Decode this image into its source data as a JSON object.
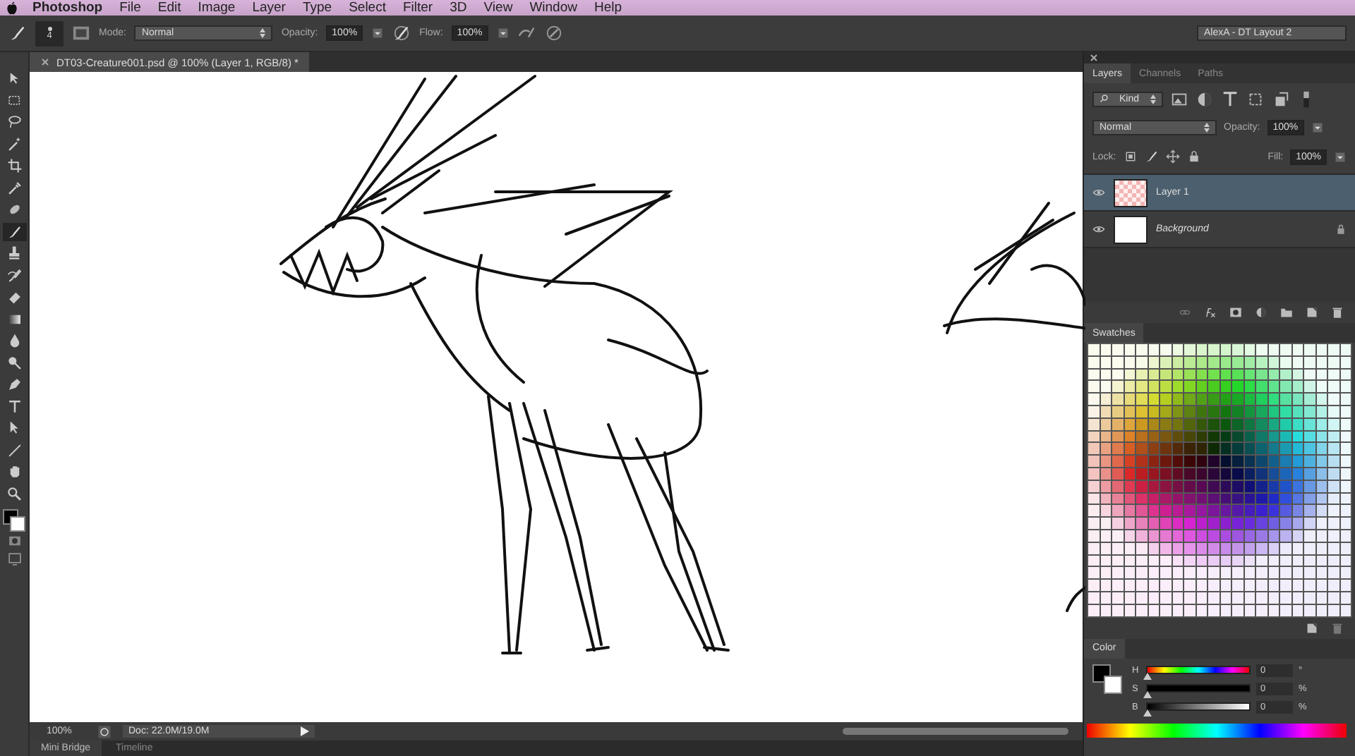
{
  "menu_bar": {
    "items": [
      "Photoshop",
      "File",
      "Edit",
      "Image",
      "Layer",
      "Type",
      "Select",
      "Filter",
      "3D",
      "View",
      "Window",
      "Help"
    ]
  },
  "options_bar": {
    "brush_size": "4",
    "mode_label": "Mode:",
    "mode": "Normal",
    "opacity_label": "Opacity:",
    "opacity": "100%",
    "flow_label": "Flow:",
    "flow": "100%",
    "workspace": "AlexA - DT Layout 2"
  },
  "tools": [
    {
      "kind": "move",
      "selected": false
    },
    {
      "kind": "marquee",
      "selected": false
    },
    {
      "kind": "lasso",
      "selected": false
    },
    {
      "kind": "wand",
      "selected": false
    },
    {
      "kind": "crop",
      "selected": false
    },
    {
      "kind": "eyedropper",
      "selected": false
    },
    {
      "kind": "healing",
      "selected": false
    },
    {
      "kind": "brush",
      "selected": true
    },
    {
      "kind": "stamp",
      "selected": false
    },
    {
      "kind": "history",
      "selected": false
    },
    {
      "kind": "eraser",
      "selected": false
    },
    {
      "kind": "gradient",
      "selected": false
    },
    {
      "kind": "blur",
      "selected": false
    },
    {
      "kind": "dodge",
      "selected": false
    },
    {
      "kind": "pen",
      "selected": false
    },
    {
      "kind": "type",
      "selected": false
    },
    {
      "kind": "pointer",
      "selected": false
    },
    {
      "kind": "line",
      "selected": false
    },
    {
      "kind": "hand",
      "selected": false
    },
    {
      "kind": "zoom",
      "selected": false
    }
  ],
  "document_tab": {
    "title": "DT03-Creature001.psd @ 100% (Layer 1, RGB/8) *"
  },
  "status_bar": {
    "zoom": "100%",
    "doc_info": "Doc: 22.0M/19.0M"
  },
  "bottom_tabs": [
    {
      "label": "Mini Bridge",
      "selected": true
    },
    {
      "label": "Timeline",
      "selected": false
    }
  ],
  "layers_panel": {
    "tabs": [
      {
        "label": "Layers",
        "selected": true
      },
      {
        "label": "Channels",
        "selected": false
      },
      {
        "label": "Paths",
        "selected": false
      }
    ],
    "filter": "Kind",
    "blend_mode": "Normal",
    "opacity_label": "Opacity:",
    "opacity": "100%",
    "lock_label": "Lock:",
    "fill_label": "Fill:",
    "fill": "100%",
    "layers": [
      {
        "name": "Layer 1",
        "kind": "transparent",
        "visible": true,
        "locked": false,
        "selected": true
      },
      {
        "name": "Background",
        "kind": "white",
        "visible": true,
        "locked": true,
        "selected": false
      }
    ]
  },
  "swatches_panel": {
    "title": "Swatches"
  },
  "color_panel": {
    "title": "Color",
    "sliders": [
      {
        "label": "H",
        "kind": "hue",
        "level": 0,
        "value": "0",
        "unit": "°"
      },
      {
        "label": "S",
        "kind": "saturation",
        "level": 0,
        "value": "0",
        "unit": "%"
      },
      {
        "label": "B",
        "kind": "brightness",
        "level": 0,
        "value": "0",
        "unit": "%"
      }
    ]
  }
}
